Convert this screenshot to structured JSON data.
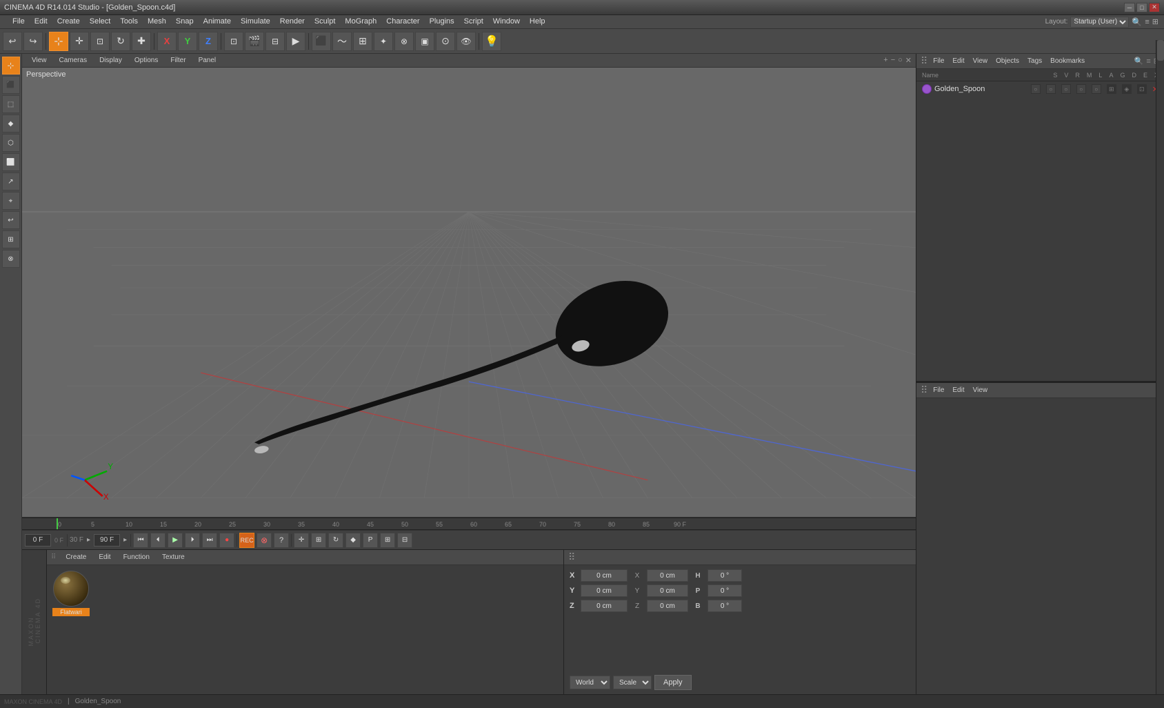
{
  "titlebar": {
    "title": "CINEMA 4D R14.014 Studio - [Golden_Spoon.c4d]",
    "minimize": "─",
    "maximize": "□",
    "close": "✕"
  },
  "menubar": {
    "items": [
      "File",
      "Edit",
      "Create",
      "Select",
      "Tools",
      "Mesh",
      "Snap",
      "Animate",
      "Simulate",
      "Render",
      "Sculpt",
      "MoGraph",
      "Character",
      "Plugins",
      "Script",
      "Window",
      "Help"
    ]
  },
  "viewport": {
    "tabs": [
      "View",
      "Cameras",
      "Display",
      "Options",
      "Filter",
      "Panel"
    ],
    "perspective_label": "Perspective",
    "controls": [
      "+",
      "−",
      "○"
    ]
  },
  "timeline": {
    "current_frame": "0 F",
    "start_frame": "0 F",
    "end_frame": "90 F",
    "fps": "30 F",
    "markers": [
      "0",
      "5",
      "10",
      "15",
      "20",
      "25",
      "30",
      "35",
      "40",
      "45",
      "50",
      "55",
      "60",
      "65",
      "70",
      "75",
      "80",
      "85",
      "90 F"
    ]
  },
  "material_panel": {
    "tabs": [
      "Create",
      "Edit",
      "Function",
      "Texture"
    ],
    "materials": [
      {
        "name": "Flatwari",
        "highlight": true
      }
    ]
  },
  "coordinates": {
    "x_pos": "0 cm",
    "y_pos": "0 cm",
    "z_pos": "0 cm",
    "x_rot": "0 cm",
    "y_rot": "0 cm",
    "z_rot": "0 cm",
    "h_val": "0 °",
    "p_val": "0 °",
    "b_val": "0 °",
    "world_label": "World",
    "scale_label": "Scale",
    "apply_label": "Apply"
  },
  "objects_panel": {
    "header_items": [
      "File",
      "Edit",
      "View"
    ],
    "columns": {
      "name": "Name",
      "flags": [
        "S",
        "V",
        "R",
        "M",
        "L",
        "A",
        "G",
        "D",
        "E",
        "X"
      ]
    },
    "objects": [
      {
        "name": "Golden_Spoon",
        "type": "group",
        "color": "#9955cc"
      }
    ]
  },
  "properties_panel": {
    "header_items": [
      "File",
      "Edit",
      "View"
    ]
  },
  "layout": {
    "label": "Layout:",
    "value": "Startup (User)"
  },
  "icons": {
    "undo": "↩",
    "redo": "↪",
    "move": "✛",
    "rotate": "↺",
    "scale": "⊞",
    "render": "▶",
    "play": "▶",
    "stop": "■",
    "rewind": "⏮",
    "step_back": "⏴",
    "step_fwd": "⏵",
    "fast_fwd": "⏭",
    "record": "⏺"
  }
}
